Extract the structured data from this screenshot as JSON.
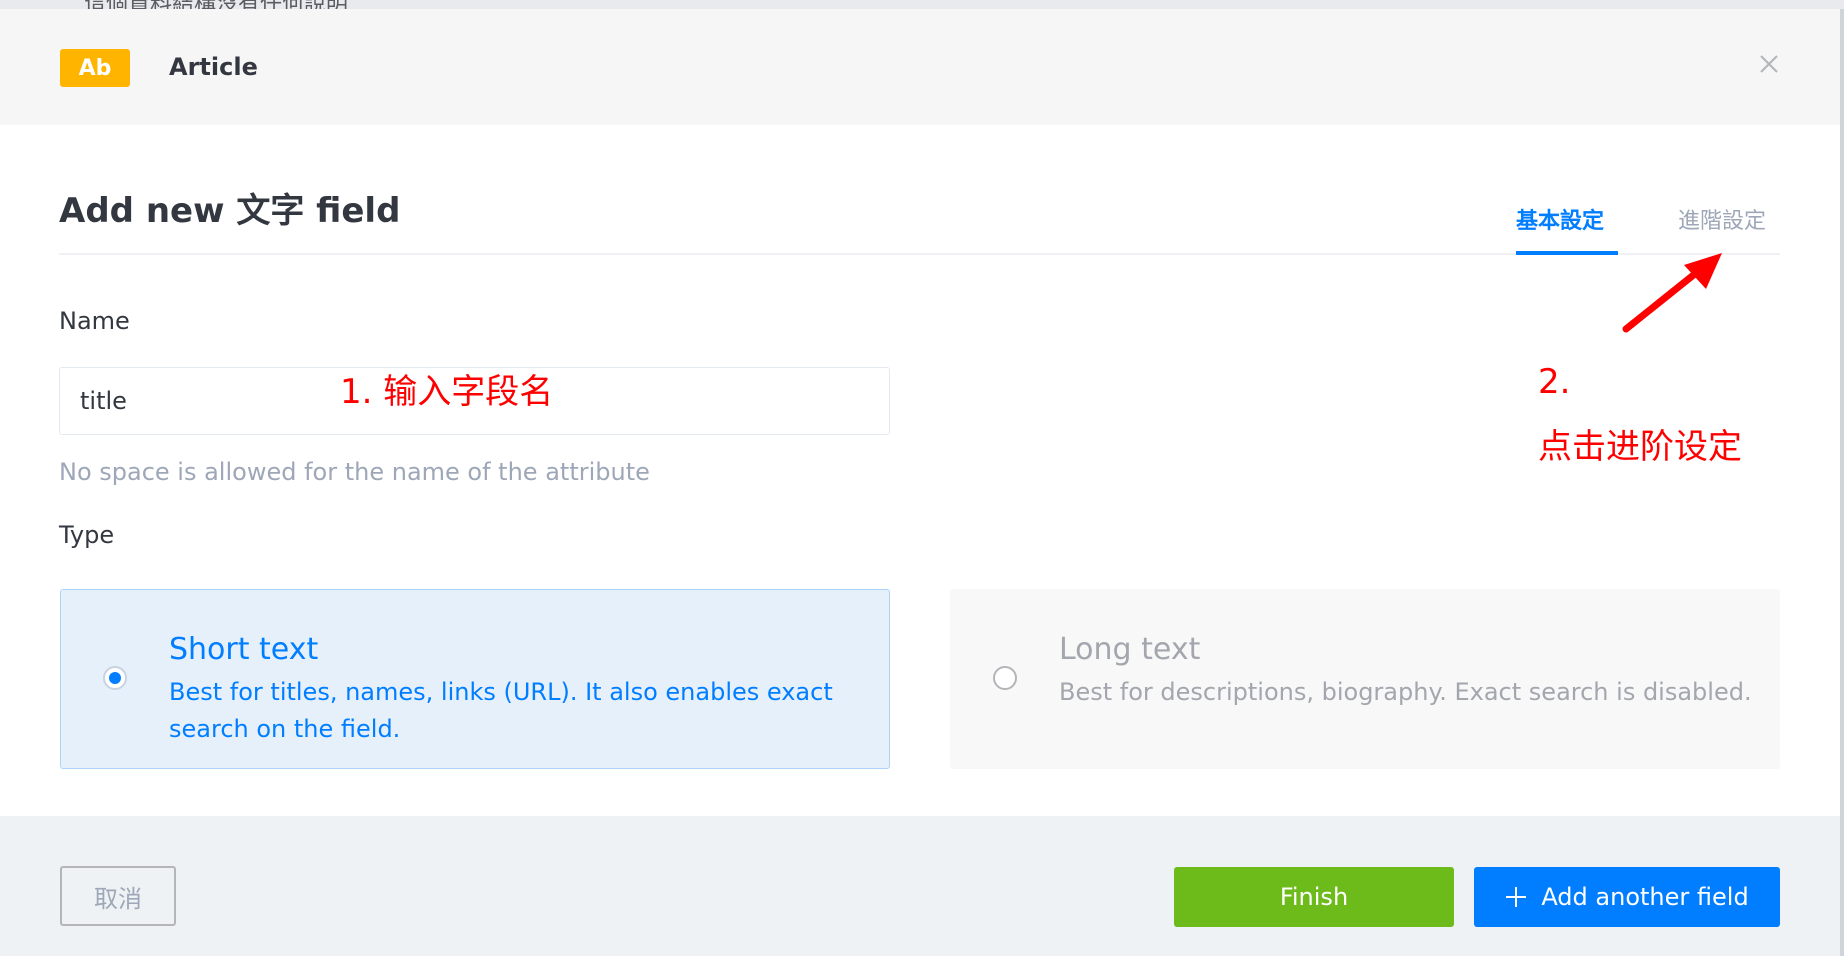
{
  "backdrop": {
    "text": "這個資料結構沒有任何說明"
  },
  "modal": {
    "header": {
      "badge": "Ab",
      "title": "Article"
    },
    "form_title": "Add new 文字 field",
    "tabs": [
      {
        "label": "基本設定",
        "active": true
      },
      {
        "label": "進階設定",
        "active": false
      }
    ],
    "name": {
      "label": "Name",
      "value": "title",
      "hint": "No space is allowed for the name of the attribute"
    },
    "type": {
      "label": "Type",
      "options": [
        {
          "title": "Short text",
          "description": "Best for titles, names, links (URL). It also enables exact search on the field.",
          "selected": true
        },
        {
          "title": "Long text",
          "description": "Best for descriptions, biography. Exact search is disabled.",
          "selected": false
        }
      ]
    },
    "footer": {
      "cancel_label": "取消",
      "finish_label": "Finish",
      "add_another_label": "Add another field"
    }
  },
  "annotations": {
    "step1": "1. 输入字段名",
    "step2_number": "2.",
    "step2_text": "点击进阶设定",
    "color": "#ff0000"
  },
  "colors": {
    "accent": "#007eff",
    "badge": "#ffb500",
    "finish": "#6dbb1a"
  }
}
